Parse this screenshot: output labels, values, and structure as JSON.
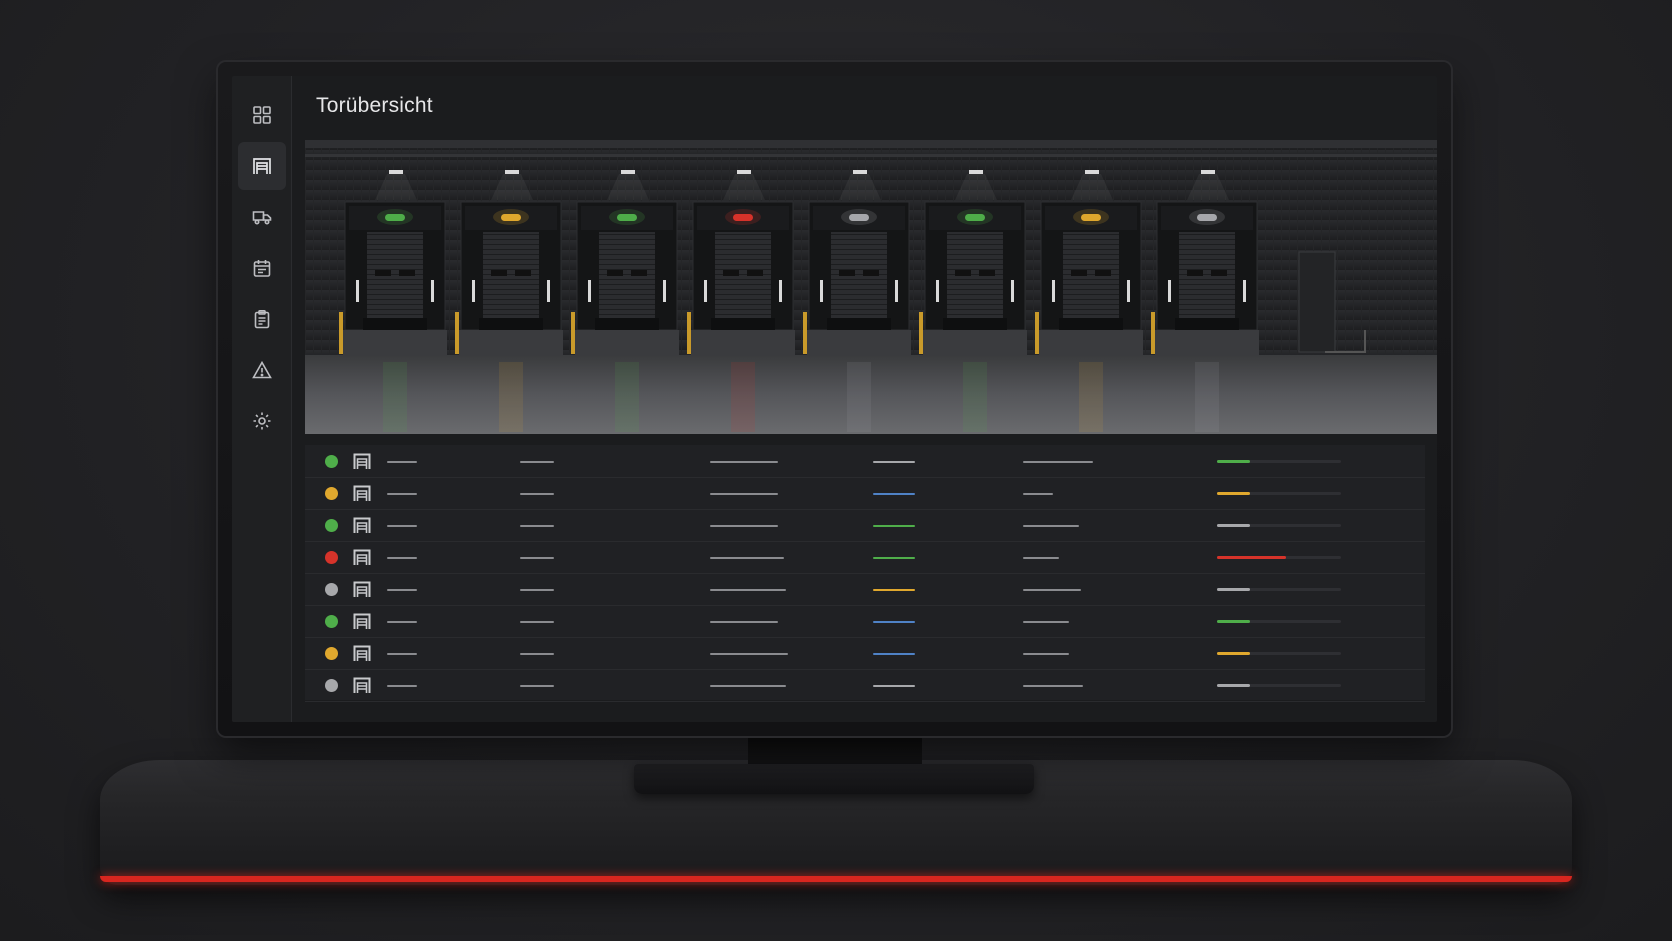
{
  "page": {
    "title": "Torübersicht"
  },
  "colors": {
    "status_green": "#4fae4a",
    "status_yellow": "#e0a82e",
    "status_red": "#d6332a",
    "status_gray": "#a7a8ab",
    "accent_blue": "#4f82c6",
    "base_glow": "#d8261f"
  },
  "sidebar": {
    "items": [
      {
        "icon": "dashboard-grid-icon",
        "active": false
      },
      {
        "icon": "dock-gate-icon",
        "active": true
      },
      {
        "icon": "truck-icon",
        "active": false
      },
      {
        "icon": "calendar-icon",
        "active": false
      },
      {
        "icon": "clipboard-icon",
        "active": false
      },
      {
        "icon": "warning-icon",
        "active": false
      },
      {
        "icon": "settings-gear-icon",
        "active": false
      }
    ]
  },
  "hero": {
    "gates": [
      {
        "signal": "green"
      },
      {
        "signal": "yellow"
      },
      {
        "signal": "green"
      },
      {
        "signal": "red"
      },
      {
        "signal": "gray"
      },
      {
        "signal": "green"
      },
      {
        "signal": "yellow"
      },
      {
        "signal": "gray"
      }
    ]
  },
  "table": {
    "rows": [
      {
        "status": "green",
        "tag_color": "gray",
        "progress": 0.27,
        "progress_color": "green"
      },
      {
        "status": "yellow",
        "tag_color": "blue",
        "progress": 0.27,
        "progress_color": "yellow"
      },
      {
        "status": "green",
        "tag_color": "green",
        "progress": 0.27,
        "progress_color": "gray"
      },
      {
        "status": "red",
        "tag_color": "green",
        "progress": 0.56,
        "progress_color": "red"
      },
      {
        "status": "gray",
        "tag_color": "yellow",
        "progress": 0.27,
        "progress_color": "gray"
      },
      {
        "status": "green",
        "tag_color": "blue",
        "progress": 0.27,
        "progress_color": "green"
      },
      {
        "status": "yellow",
        "tag_color": "blue",
        "progress": 0.27,
        "progress_color": "yellow"
      },
      {
        "status": "gray",
        "tag_color": "gray",
        "progress": 0.27,
        "progress_color": "gray"
      }
    ]
  }
}
